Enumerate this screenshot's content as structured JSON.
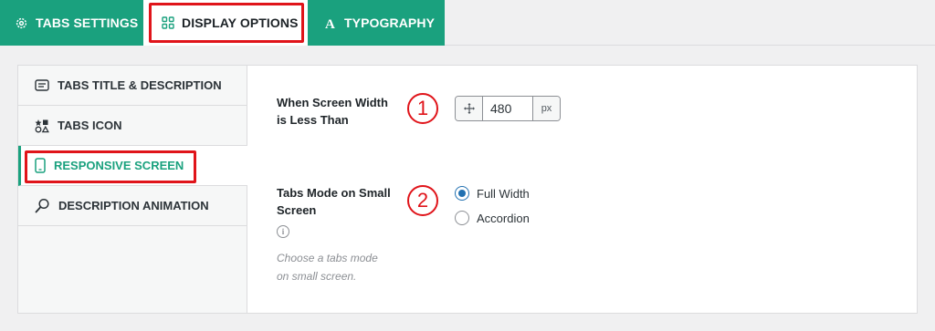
{
  "top_tabs": [
    {
      "label": "TABS SETTINGS",
      "icon": "gear-icon"
    },
    {
      "label": "DISPLAY OPTIONS",
      "icon": "grid-icon"
    },
    {
      "label": "TYPOGRAPHY",
      "icon": "font-icon"
    }
  ],
  "side_menu": [
    {
      "label": "TABS TITLE & DESCRIPTION",
      "icon": "text-box-icon"
    },
    {
      "label": "TABS ICON",
      "icon": "shapes-icon"
    },
    {
      "label": "RESPONSIVE SCREEN",
      "icon": "mobile-icon"
    },
    {
      "label": "DESCRIPTION ANIMATION",
      "icon": "magic-wand-icon"
    }
  ],
  "fields": {
    "screen_width": {
      "label_line1": "When Screen Width",
      "label_line2": "is Less Than",
      "value": "480",
      "unit": "px",
      "badge": "1"
    },
    "tabs_mode": {
      "label_line1": "Tabs Mode on Small",
      "label_line2": "Screen",
      "badge": "2",
      "info": "i",
      "help_line1": "Choose a tabs mode",
      "help_line2": "on small screen.",
      "options": [
        {
          "label": "Full Width",
          "checked": true
        },
        {
          "label": "Accordion",
          "checked": false
        }
      ]
    }
  },
  "colors": {
    "accent": "#1aa17e",
    "highlight": "#e0141a",
    "radio_checked": "#2271b1"
  }
}
